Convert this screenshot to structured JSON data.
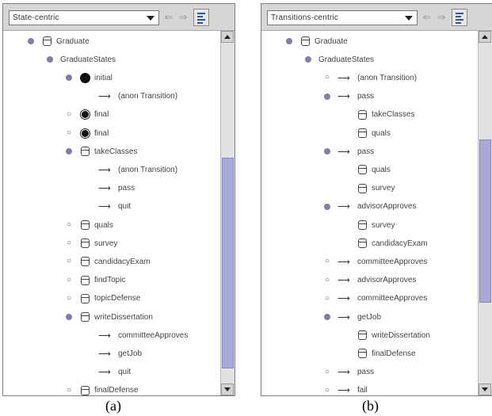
{
  "panels": [
    {
      "id": "a",
      "view_select": "State-centric",
      "caption": "(a)",
      "rows": [
        {
          "marker": "dot",
          "icon": "state-box",
          "label": "Graduate",
          "indent": 0
        },
        {
          "marker": "dot",
          "icon": "none",
          "label": "GraduateStates",
          "indent": 1
        },
        {
          "marker": "dot",
          "icon": "initial",
          "label": "initial",
          "indent": 2
        },
        {
          "marker": "none",
          "icon": "arrow",
          "label": "(anon Transition)",
          "indent": 3
        },
        {
          "marker": "circle",
          "icon": "final",
          "label": "final",
          "indent": 2
        },
        {
          "marker": "circle",
          "icon": "final",
          "label": "final",
          "indent": 2
        },
        {
          "marker": "dot",
          "icon": "state",
          "label": "takeClasses",
          "indent": 2
        },
        {
          "marker": "none",
          "icon": "arrow",
          "label": "(anon Transition)",
          "indent": 3
        },
        {
          "marker": "none",
          "icon": "arrow",
          "label": "pass",
          "indent": 3
        },
        {
          "marker": "none",
          "icon": "arrow",
          "label": "quit",
          "indent": 3
        },
        {
          "marker": "circle",
          "icon": "state",
          "label": "quals",
          "indent": 2
        },
        {
          "marker": "circle",
          "icon": "state",
          "label": "survey",
          "indent": 2
        },
        {
          "marker": "circle",
          "icon": "state",
          "label": "candidacyExam",
          "indent": 2
        },
        {
          "marker": "circle",
          "icon": "state",
          "label": "findTopic",
          "indent": 2
        },
        {
          "marker": "circle",
          "icon": "state",
          "label": "topicDefense",
          "indent": 2
        },
        {
          "marker": "dot",
          "icon": "state",
          "label": "writeDissertation",
          "indent": 2
        },
        {
          "marker": "none",
          "icon": "arrow",
          "label": "committeeApproves",
          "indent": 3
        },
        {
          "marker": "none",
          "icon": "arrow",
          "label": "getJob",
          "indent": 3
        },
        {
          "marker": "none",
          "icon": "arrow",
          "label": "quit",
          "indent": 3
        },
        {
          "marker": "circle",
          "icon": "state",
          "label": "finalDefense",
          "indent": 2
        }
      ]
    },
    {
      "id": "b",
      "view_select": "Transitions-centric",
      "caption": "(b)",
      "rows": [
        {
          "marker": "dot",
          "icon": "state-box",
          "label": "Graduate",
          "indent": 0
        },
        {
          "marker": "dot",
          "icon": "none",
          "label": "GraduateStates",
          "indent": 1
        },
        {
          "marker": "circle",
          "icon": "arrow",
          "label": "(anon Transition)",
          "indent": 2
        },
        {
          "marker": "dot",
          "icon": "arrow",
          "label": "pass",
          "indent": 2
        },
        {
          "marker": "none",
          "icon": "state",
          "label": "takeClasses",
          "indent": 3
        },
        {
          "marker": "none",
          "icon": "state",
          "label": "quals",
          "indent": 3
        },
        {
          "marker": "dot",
          "icon": "arrow",
          "label": "pass",
          "indent": 2
        },
        {
          "marker": "none",
          "icon": "state",
          "label": "quals",
          "indent": 3
        },
        {
          "marker": "none",
          "icon": "state",
          "label": "survey",
          "indent": 3
        },
        {
          "marker": "dot",
          "icon": "arrow",
          "label": "advisorApproves",
          "indent": 2
        },
        {
          "marker": "none",
          "icon": "state",
          "label": "survey",
          "indent": 3
        },
        {
          "marker": "none",
          "icon": "state",
          "label": "candidacyExam",
          "indent": 3
        },
        {
          "marker": "circle",
          "icon": "arrow",
          "label": "committeeApproves",
          "indent": 2
        },
        {
          "marker": "circle",
          "icon": "arrow",
          "label": "advisorApproves",
          "indent": 2
        },
        {
          "marker": "circle",
          "icon": "arrow",
          "label": "committeeApproves",
          "indent": 2
        },
        {
          "marker": "dot",
          "icon": "arrow",
          "label": "getJob",
          "indent": 2
        },
        {
          "marker": "none",
          "icon": "state",
          "label": "writeDissertation",
          "indent": 3
        },
        {
          "marker": "none",
          "icon": "state",
          "label": "finalDefense",
          "indent": 3
        },
        {
          "marker": "circle",
          "icon": "arrow",
          "label": "pass",
          "indent": 2
        },
        {
          "marker": "circle",
          "icon": "arrow",
          "label": "fail",
          "indent": 2
        }
      ]
    }
  ]
}
